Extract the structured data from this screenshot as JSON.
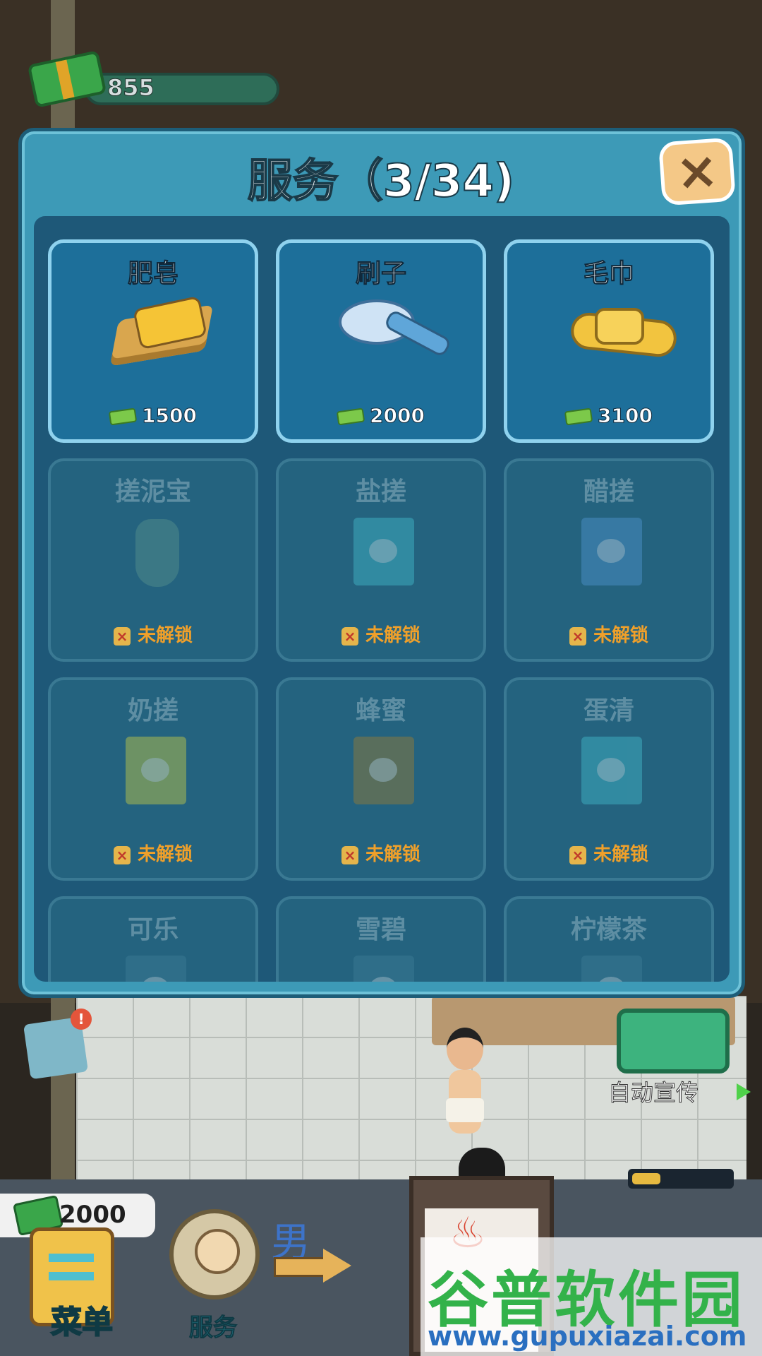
{
  "hud": {
    "money": "855"
  },
  "modal": {
    "title": "服务（3/34)",
    "close_icon": "close-x-icon",
    "items": [
      {
        "name": "肥皂",
        "status": "unlocked",
        "price": "1500",
        "icon": "soap-icon"
      },
      {
        "name": "刷子",
        "status": "unlocked",
        "price": "2000",
        "icon": "brush-icon"
      },
      {
        "name": "毛巾",
        "status": "unlocked",
        "price": "3100",
        "icon": "towel-icon"
      },
      {
        "name": "搓泥宝",
        "status": "locked",
        "lock_text": "未解锁",
        "icon": "bottle-icon"
      },
      {
        "name": "盐搓",
        "status": "locked",
        "lock_text": "未解锁",
        "icon": "salt-pack-icon"
      },
      {
        "name": "醋搓",
        "status": "locked",
        "lock_text": "未解锁",
        "icon": "vinegar-pack-icon"
      },
      {
        "name": "奶搓",
        "status": "locked",
        "lock_text": "未解锁",
        "icon": "milk-pack-icon"
      },
      {
        "name": "蜂蜜",
        "status": "locked",
        "lock_text": "未解锁",
        "icon": "honey-pack-icon"
      },
      {
        "name": "蛋清",
        "status": "locked",
        "lock_text": "未解锁",
        "icon": "egg-pack-icon"
      },
      {
        "name": "可乐",
        "status": "locked",
        "icon": "cola-icon"
      },
      {
        "name": "雪碧",
        "status": "locked",
        "icon": "sprite-icon"
      },
      {
        "name": "柠檬茶",
        "status": "locked",
        "icon": "lemon-tea-icon"
      }
    ]
  },
  "scene": {
    "auto_promo_label": "自动宣传",
    "alert_badge": "!",
    "bottom_money": "2000",
    "menu_label": "菜单",
    "service_label": "服务",
    "gender_label": "男"
  },
  "watermark": {
    "title": "谷普软件园",
    "url": "www.gupuxiazai.com"
  },
  "colors": {
    "panel": "#3d9ab7",
    "panel_inner": "#1e5878",
    "card_unlocked": "#1d6f9a",
    "card_border_unlocked": "#8fd2ee",
    "lock_text": "#f0a02a"
  }
}
